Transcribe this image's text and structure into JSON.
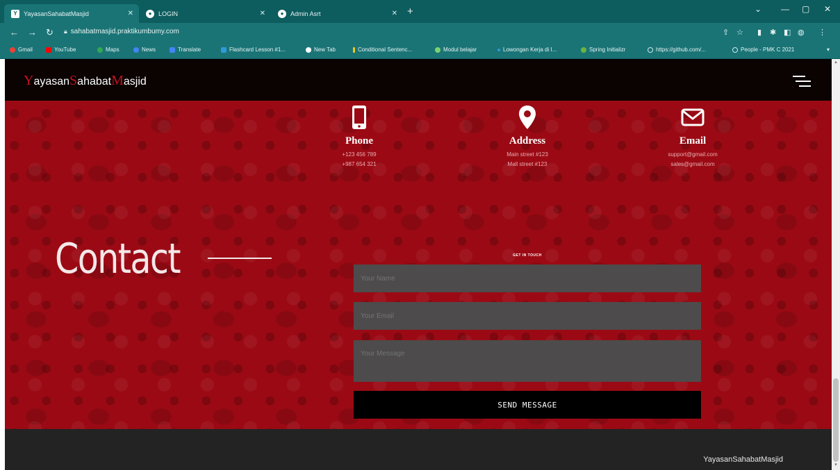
{
  "browser": {
    "tabs": [
      {
        "label": "YayasanSahabatMasjid",
        "active": true
      },
      {
        "label": "LOGIN",
        "active": false
      },
      {
        "label": "Admin Asrt",
        "active": false
      }
    ],
    "url": "sahabatmasjid.praktikumbumy.com",
    "bookmarks": [
      "Gmail",
      "YouTube",
      "Maps",
      "News",
      "Translate",
      "Flashcard Lesson #1...",
      "New Tab",
      "Conditional Sentenc...",
      "Modul belajar",
      "Lowongan Kerja di I...",
      "Spring Initializr",
      "https://github.com/...",
      "People - PMK C 2021"
    ]
  },
  "site": {
    "brand": {
      "parts": [
        {
          "cap": "Y",
          "rest": "ayasan"
        },
        {
          "cap": "S",
          "rest": "ahabat"
        },
        {
          "cap": "M",
          "rest": "asjid"
        }
      ]
    },
    "info": [
      {
        "icon": "phone-icon",
        "title": "Phone",
        "lines": [
          "+123 456 789",
          "+987 654 321"
        ]
      },
      {
        "icon": "location-pin-icon",
        "title": "Address",
        "lines": [
          "Main street #123",
          "Mall street #123"
        ]
      },
      {
        "icon": "envelope-icon",
        "title": "Email",
        "lines": [
          "support@gmail.com",
          "sales@gmail.com"
        ]
      }
    ],
    "contact_heading": "Contact",
    "form": {
      "eyebrow": "GET IN TOUCH",
      "name_placeholder": "Your Name",
      "email_placeholder": "Your Email",
      "message_placeholder": "Your Message",
      "submit_label": "SEND MESSAGE"
    },
    "footer_brand": "YayasanSahabatMasjid"
  },
  "colors": {
    "browser_frame": "#0d5c5e",
    "header_bg": "#0b0202",
    "hero_red": "#9b0a14",
    "logo_accent": "#c3121f",
    "field_bg": "#4d4b4b",
    "footer_bg": "#232323"
  }
}
